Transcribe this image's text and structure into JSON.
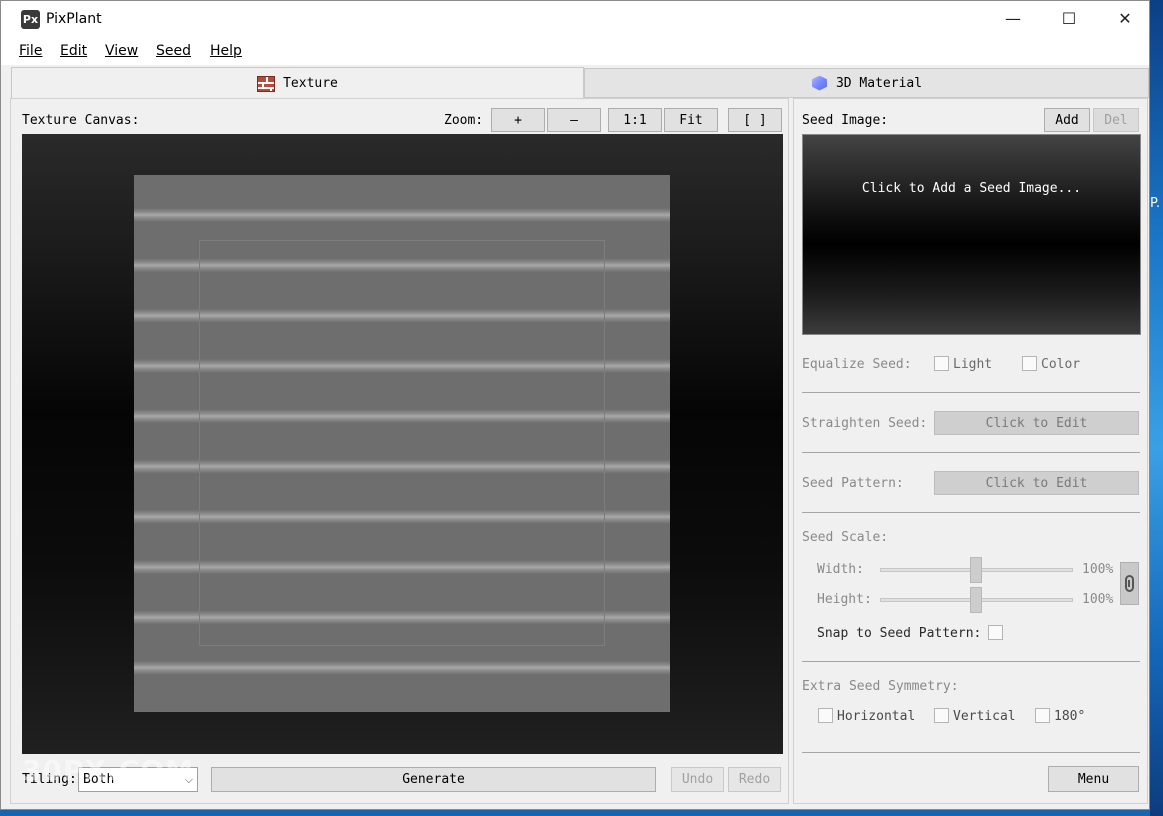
{
  "window": {
    "title": "PixPlant",
    "icon_text": "Px",
    "minimize": "—",
    "maximize": "☐",
    "close": "✕"
  },
  "menu": {
    "items": [
      "File",
      "Edit",
      "View",
      "Seed",
      "Help"
    ]
  },
  "tabs": [
    {
      "label": "Texture"
    },
    {
      "label": "3D Material"
    }
  ],
  "canvas": {
    "label": "Texture Canvas:",
    "zoom_label": "Zoom:",
    "zoom_in": "+",
    "zoom_out": "—",
    "zoom_actual": "1:1",
    "zoom_fit": "Fit",
    "zoom_frame": "[ ]"
  },
  "bottom": {
    "tiling_label": "Tiling:",
    "tiling_value": "Both",
    "generate": "Generate",
    "undo": "Undo",
    "redo": "Redo",
    "watermark": "30PX.COM"
  },
  "seed": {
    "label": "Seed Image:",
    "add": "Add",
    "del": "Del",
    "hint": "Click to Add a Seed Image...",
    "equalize_label": "Equalize Seed:",
    "equalize_light": "Light",
    "equalize_color": "Color",
    "straighten_label": "Straighten Seed:",
    "straighten_btn": "Click to Edit",
    "pattern_label": "Seed Pattern:",
    "pattern_btn": "Click to Edit",
    "scale_label": "Seed Scale:",
    "width_label": "Width:",
    "width_value": "100%",
    "height_label": "Height:",
    "height_value": "100%",
    "snap_label": "Snap to Seed Pattern:",
    "symmetry_label": "Extra Seed Symmetry:",
    "sym_horizontal": "Horizontal",
    "sym_vertical": "Vertical",
    "sym_180": "180°",
    "menu": "Menu"
  },
  "desktop": {
    "edge_text": "P."
  }
}
